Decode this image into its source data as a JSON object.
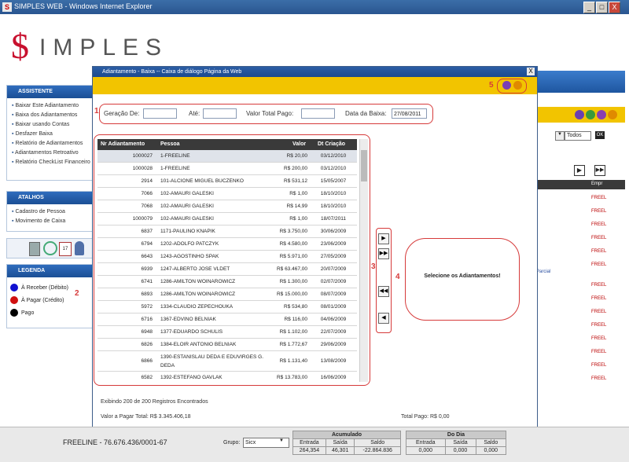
{
  "window": {
    "title": "SIMPLES WEB - Windows Internet Explorer",
    "min": "_",
    "max": "□",
    "close": "X"
  },
  "logo": {
    "first": "$",
    "rest": "IMPLES"
  },
  "sidebar": {
    "assistente": {
      "title": "ASSISTENTE",
      "items": [
        "Baixar Este Adiantamento",
        "Baixa dos Adiantamentos",
        "Baixar usando Contas",
        "Desfazer Baixa",
        "Relatório de Adiantamentos",
        "Adiantamentos Retroativo",
        "Relatório CheckList Financeiro"
      ]
    },
    "atalhos": {
      "title": "ATALHOS",
      "items": [
        "Cadastro de Pessoa",
        "Movimento de Caixa"
      ]
    },
    "legenda": {
      "title": "LEGENDA",
      "items": [
        {
          "label": "À Receber (Débito)",
          "color": "#1010d0"
        },
        {
          "label": "À Pagar (Crédito)",
          "color": "#d01010"
        },
        {
          "label": "Pago",
          "color": "#000000"
        }
      ]
    }
  },
  "background": {
    "filter_value": "Todos",
    "filter_btn": "OK",
    "col_header": "Empr",
    "row_text": "FREEL",
    "parcial": "Parcial"
  },
  "dialog": {
    "title": "Adiantamento - Baixa -- Caixa de diálogo Página da Web",
    "close": "X",
    "filters": {
      "geracao_label": "Geração De:",
      "ate_label": "Até:",
      "valor_label": "Valor Total Pago:",
      "data_label": "Data da Baixa:",
      "data_value": "27/08/2011"
    },
    "table": {
      "columns": [
        "Nr Adiantamento",
        "Pessoa",
        "Valor",
        "Dt Criação"
      ],
      "rows": [
        [
          "1000027",
          "1-FREELINE",
          "R$ 20,00",
          "03/12/2010"
        ],
        [
          "1000028",
          "1-FREELINE",
          "R$ 200,00",
          "03/12/2010"
        ],
        [
          "2914",
          "101-ALCIONE MIGUEL BUCZENKO",
          "R$ 531,12",
          "15/05/2007"
        ],
        [
          "7066",
          "102-AMAURI GALESKI",
          "R$ 1,00",
          "18/10/2010"
        ],
        [
          "7068",
          "102-AMAURI GALESKI",
          "R$ 14,99",
          "18/10/2010"
        ],
        [
          "1000079",
          "102-AMAURI GALESKI",
          "R$ 1,00",
          "18/07/2011"
        ],
        [
          "6837",
          "1171-PAULINO KNAPIK",
          "R$ 3.750,00",
          "30/06/2009"
        ],
        [
          "6794",
          "1202-ADOLFO PATCZYK",
          "R$ 4.580,00",
          "23/06/2009"
        ],
        [
          "6643",
          "1243-AGOSTINHO SPAK",
          "R$ 5.971,00",
          "27/05/2009"
        ],
        [
          "6939",
          "1247-ALBERTO JOSE VLDET",
          "R$ 63.467,00",
          "20/07/2009"
        ],
        [
          "6741",
          "1286-AMILTON WOINAROWICZ",
          "R$ 1.300,00",
          "02/07/2009"
        ],
        [
          "6893",
          "1286-AMILTON WOINAROWICZ",
          "R$ 15.000,00",
          "08/07/2009"
        ],
        [
          "5972",
          "1334-CLAUDIO ZEPECHOUKA",
          "R$ 534,80",
          "08/01/2009"
        ],
        [
          "6716",
          "1367-EDVINO BELNIAK",
          "R$ 116,00",
          "04/06/2009"
        ],
        [
          "6948",
          "1377-EDUARDO SCHULIS",
          "R$ 1.102,00",
          "22/07/2009"
        ],
        [
          "6826",
          "1384-ELOIR ANTONIO BELNIAK",
          "R$ 1.772,67",
          "29/06/2009"
        ],
        [
          "6866",
          "1390-ESTANISLAU DEDA E EDUVIRGES G. DEDA",
          "R$ 1.131,40",
          "13/08/2009"
        ],
        [
          "6582",
          "1392-ESTEFANO GAVLAK",
          "R$ 13.783,00",
          "16/06/2009"
        ]
      ]
    },
    "buttons": {
      "add": "▶",
      "add_all": "▶▶",
      "remove_all": "◀◀",
      "remove": "◀"
    },
    "selected_placeholder": "Selecione os Adiantamentos!",
    "footer": {
      "count": "Exibindo 200 de 200 Registros Encontrados",
      "total_label": "Valor a Pagar Total: R$ 3.345.406,18",
      "paid_label": "Total Pago: R$ 0,00"
    },
    "markers": [
      "1",
      "2",
      "3",
      "4",
      "5"
    ]
  },
  "status": {
    "company": "FREELINE - 76.676.436/0001-67",
    "grupo_label": "Grupo:",
    "grupo_value": "Sicx",
    "acumulado": {
      "title": "Acumulado",
      "cols": [
        "Entrada",
        "Saída",
        "Saldo"
      ],
      "vals": [
        "264,354",
        "46,301",
        "-22.864.836"
      ]
    },
    "dodia": {
      "title": "Do Dia",
      "cols": [
        "Entrada",
        "Saída",
        "Saldo"
      ],
      "vals": [
        "0,000",
        "0,000",
        "0,000"
      ]
    }
  }
}
